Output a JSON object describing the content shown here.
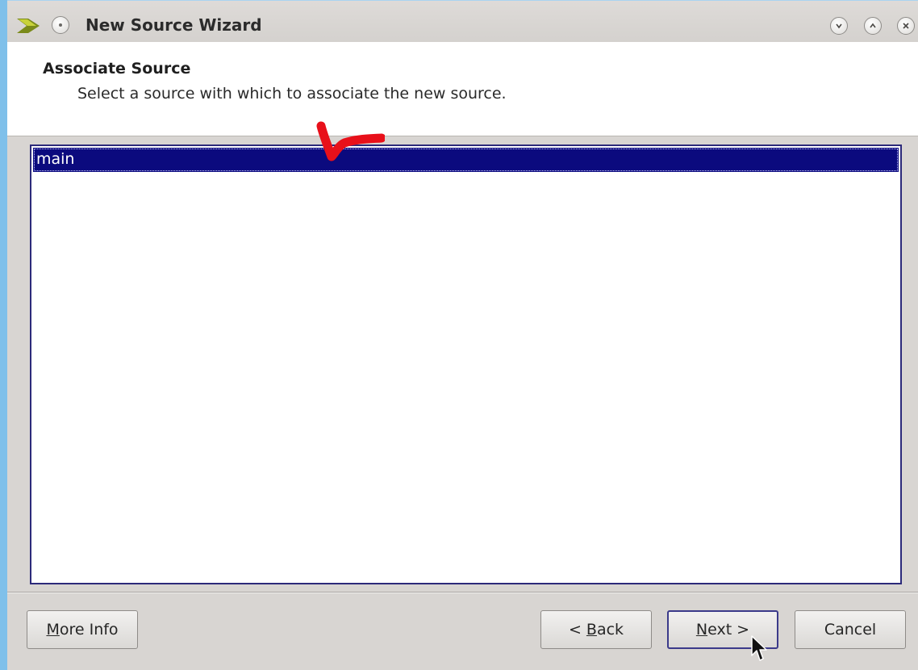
{
  "window": {
    "title": "New Source Wizard",
    "controls": {
      "minimize_icon": "chevron-down-icon",
      "maximize_icon": "chevron-up-icon",
      "close_icon": "close-icon"
    }
  },
  "header": {
    "title": "Associate Source",
    "subtitle": "Select a source with which to associate the new source."
  },
  "source_list": {
    "items": [
      {
        "label": "main",
        "selected": true
      }
    ]
  },
  "buttons": {
    "more_info": {
      "prefix": "",
      "mnemonic": "M",
      "rest": "ore Info"
    },
    "back": {
      "prefix": "< ",
      "mnemonic": "B",
      "rest": "ack"
    },
    "next": {
      "prefix": "",
      "mnemonic": "N",
      "rest": "ext >"
    },
    "cancel": {
      "label": "Cancel"
    }
  },
  "colors": {
    "selection": "#0b0a7e",
    "list_border": "#2c2a7a",
    "window_border": "#7fc0ea",
    "annotation": "#e8101a"
  }
}
